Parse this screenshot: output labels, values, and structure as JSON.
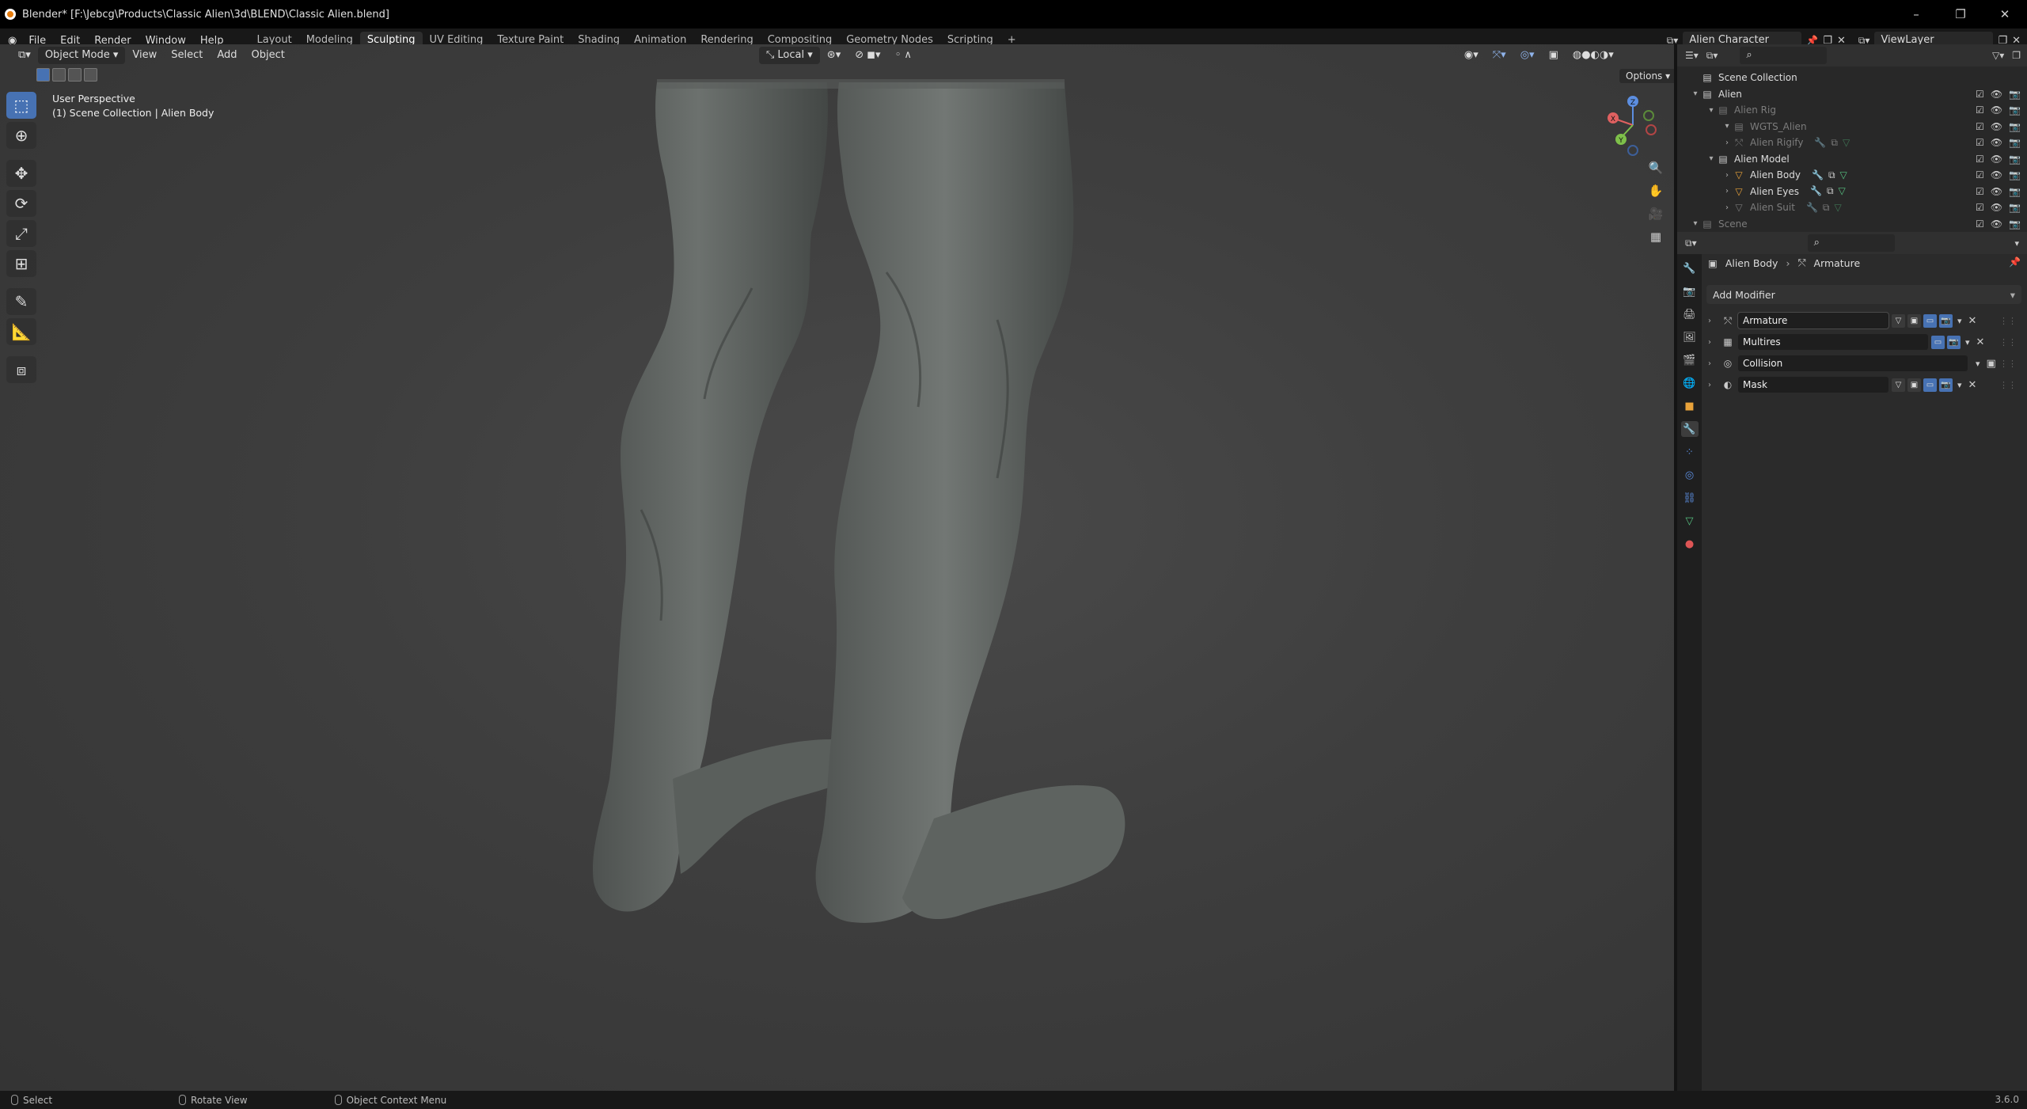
{
  "title_bar": {
    "text": "Blender* [F:\\Jebcg\\Products\\Classic Alien\\3d\\BLEND\\Classic Alien.blend]",
    "buttons": [
      "–",
      "❐",
      "✕"
    ]
  },
  "menu": {
    "items": [
      "File",
      "Edit",
      "Render",
      "Window",
      "Help"
    ],
    "workspaces": [
      "Layout",
      "Modeling",
      "Sculpting",
      "UV Editing",
      "Texture Paint",
      "Shading",
      "Animation",
      "Rendering",
      "Compositing",
      "Geometry Nodes",
      "Scripting",
      "+"
    ],
    "active_workspace": "Sculpting",
    "scene": "Alien Character",
    "view_layer": "ViewLayer"
  },
  "viewport": {
    "mode": "Object Mode",
    "menus": [
      "View",
      "Select",
      "Add",
      "Object"
    ],
    "transform_orientation": "Local",
    "options_label": "Options",
    "overlay_line1": "User Perspective",
    "overlay_line2": "(1) Scene Collection | Alien Body",
    "gizmo_axes": [
      "X",
      "Y",
      "Z"
    ]
  },
  "toolbar": {
    "tools": [
      "select-box",
      "cursor",
      "move",
      "rotate",
      "scale",
      "transform",
      "annotate",
      "measure",
      "add-cube"
    ]
  },
  "outliner": {
    "rows": [
      {
        "label": "Scene Collection",
        "depth": 0,
        "dim": false,
        "icon": "scene-collection-icon"
      },
      {
        "label": "Alien",
        "depth": 0,
        "dim": false,
        "icon": "collection-icon"
      },
      {
        "label": "Alien Rig",
        "depth": 1,
        "dim": true,
        "icon": "collection-icon"
      },
      {
        "label": "WGTS_Alien",
        "depth": 2,
        "dim": true,
        "icon": "collection-icon"
      },
      {
        "label": "Alien Rigify",
        "depth": 2,
        "dim": true,
        "icon": "armature-icon"
      },
      {
        "label": "Alien Model",
        "depth": 1,
        "dim": false,
        "icon": "collection-icon"
      },
      {
        "label": "Alien Body",
        "depth": 2,
        "dim": false,
        "icon": "mesh-icon"
      },
      {
        "label": "Alien Eyes",
        "depth": 2,
        "dim": false,
        "icon": "mesh-icon"
      },
      {
        "label": "Alien Suit",
        "depth": 2,
        "dim": true,
        "icon": "mesh-icon"
      },
      {
        "label": "Scene",
        "depth": 0,
        "dim": true,
        "icon": "collection-icon"
      }
    ]
  },
  "properties": {
    "breadcrumb_object": "Alien Body",
    "breadcrumb_modifier": "Armature",
    "add_modifier_label": "Add Modifier",
    "modifiers": [
      {
        "name": "Armature",
        "icon": "armature-modifier-icon"
      },
      {
        "name": "Multires",
        "icon": "multires-icon"
      },
      {
        "name": "Collision",
        "icon": "collision-icon"
      },
      {
        "name": "Mask",
        "icon": "mask-icon"
      }
    ]
  },
  "status_bar": {
    "hints": [
      "Select",
      "Rotate View",
      "Object Context Menu"
    ],
    "version": "3.6.0"
  },
  "colors": {
    "accent": "#4772b3",
    "object_orange": "#e8a23a",
    "mesh_green": "#56c281"
  }
}
